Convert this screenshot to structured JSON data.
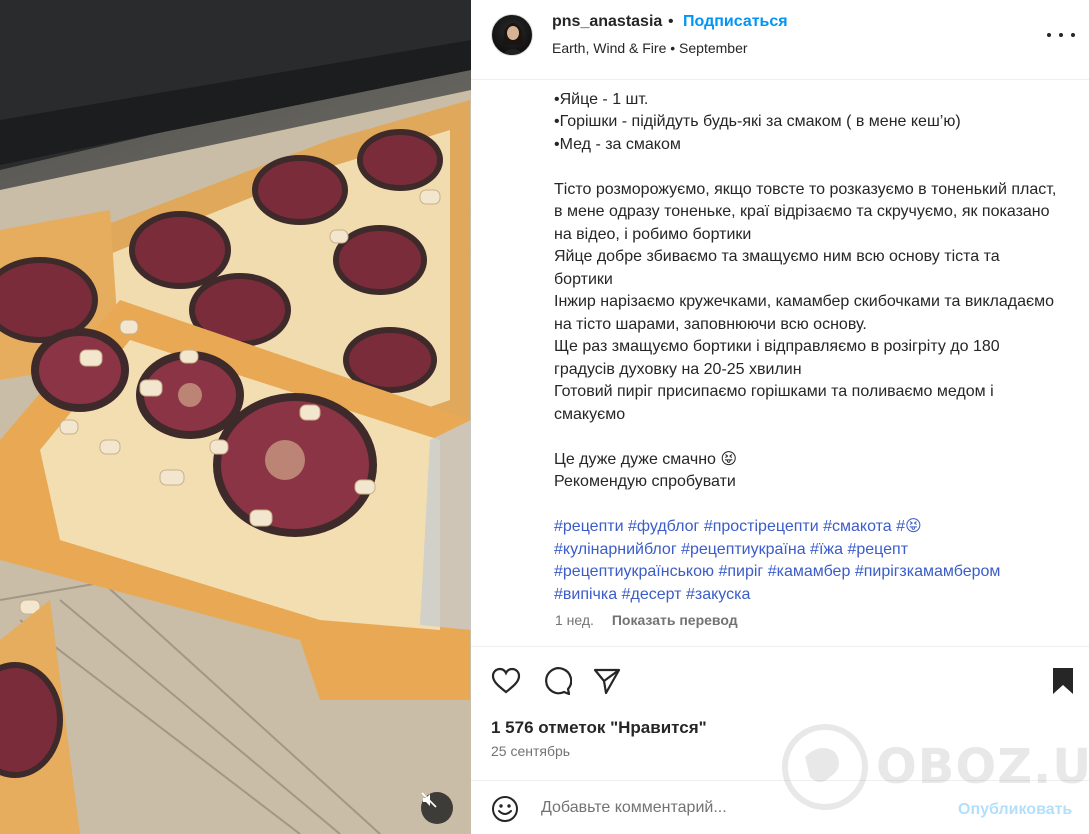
{
  "media": {
    "alt_icons": {
      "mute": "speaker-muted-icon"
    }
  },
  "header": {
    "username": "pns_anastasia",
    "separator": "•",
    "follow_label": "Подписаться",
    "music": "Earth, Wind & Fire • September",
    "more_icon": "ellipsis-icon"
  },
  "caption": {
    "lines_top": [
      "•Яйце - 1 шт.",
      "•Горішки - підійдуть будь-які за смаком ( в мене кеш’ю)",
      "•Мед - за смаком"
    ],
    "paragraph_1": "Тісто розморожуємо, якщо товсте то розказуємо в тоненький пласт, в мене одразу тоненьке, краї відрізаємо та скручуємо, як показано на відео, і робимо бортики",
    "paragraph_2": "Яйце добре збиваємо та змащуємо ним всю основу тіста та бортики",
    "paragraph_3": "Інжир нарізаємо кружечками, камамбер скибочками та викладаємо на тісто шарами, заповнюючи всю основу.",
    "paragraph_4": "Ще раз змащуємо бортики і відправляємо в розігріту до 180 градусів духовку на 20-25 хвилин",
    "paragraph_5": "Готовий пиріг присипаємо горішками та поливаємо медом і смакуємо",
    "closing_1": "Це дуже дуже смачно 😝",
    "closing_2": "Рекомендую спробувати",
    "hashtags": [
      "#рецепти",
      "#фудблог",
      "#простірецепти",
      "#смакота",
      "#😝",
      "#кулінарнийблог",
      "#рецептиукраїна",
      "#їжа",
      "#рецепт",
      "#рецептиукраїнською",
      "#пиріг",
      "#камамбер",
      "#пирігзкамамбером",
      "#випічка",
      "#десерт",
      "#закуска"
    ],
    "age": "1 нед.",
    "translate_label": "Показать перевод"
  },
  "actions": {
    "likes": "1 576 отметок \"Нравится\"",
    "date": "25 сентябрь",
    "icons": [
      "heart-icon",
      "comment-icon",
      "share-icon",
      "bookmark-icon"
    ]
  },
  "comment": {
    "placeholder": "Добавьте комментарий...",
    "publish_label": "Опубликовать"
  },
  "watermark": {
    "text": "OBOZ.UA"
  },
  "colors": {
    "link": "#0095f6",
    "hashtag": "#3b5cc9",
    "publish_disabled": "#b2dffc"
  }
}
